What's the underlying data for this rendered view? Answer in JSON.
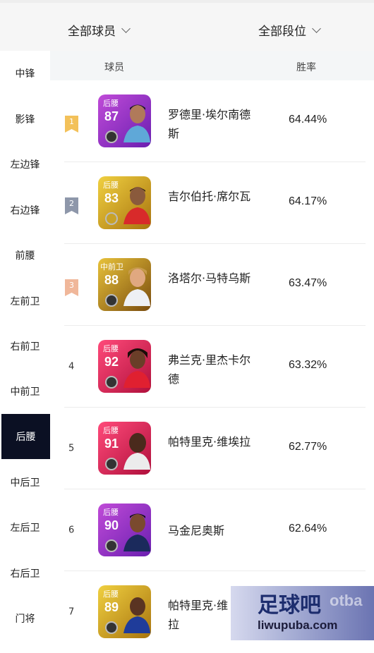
{
  "filters": {
    "players": "全部球员",
    "tiers": "全部段位"
  },
  "sidebar": {
    "items": [
      {
        "label": "中锋",
        "active": false
      },
      {
        "label": "影锋",
        "active": false
      },
      {
        "label": "左边锋",
        "active": false
      },
      {
        "label": "右边锋",
        "active": false
      },
      {
        "label": "前腰",
        "active": false
      },
      {
        "label": "左前卫",
        "active": false
      },
      {
        "label": "右前卫",
        "active": false
      },
      {
        "label": "中前卫",
        "active": false
      },
      {
        "label": "后腰",
        "active": true
      },
      {
        "label": "中后卫",
        "active": false
      },
      {
        "label": "左后卫",
        "active": false
      },
      {
        "label": "右后卫",
        "active": false
      },
      {
        "label": "门将",
        "active": false
      }
    ]
  },
  "table": {
    "headers": {
      "player": "球员",
      "winrate": "胜率"
    },
    "rows": [
      {
        "rank": "1",
        "position": "后腰",
        "rating": "87",
        "name": "罗德里·埃尔南德斯",
        "winrate": "64.44%",
        "card_color": "purple",
        "badge_color": "#f3c15a"
      },
      {
        "rank": "2",
        "position": "后腰",
        "rating": "83",
        "name": "吉尔伯托·席尔瓦",
        "winrate": "64.17%",
        "card_color": "gold",
        "badge_color": "#8e97aa"
      },
      {
        "rank": "3",
        "position": "中前卫",
        "rating": "88",
        "name": "洛塔尔·马特乌斯",
        "winrate": "63.47%",
        "card_color": "gold",
        "badge_color": "#f0b79a"
      },
      {
        "rank": "4",
        "position": "后腰",
        "rating": "92",
        "name": "弗兰克·里杰卡尔德",
        "winrate": "63.32%",
        "card_color": "pink"
      },
      {
        "rank": "5",
        "position": "后腰",
        "rating": "91",
        "name": "帕特里克·维埃拉",
        "winrate": "62.77%",
        "card_color": "pink"
      },
      {
        "rank": "6",
        "position": "后腰",
        "rating": "90",
        "name": "马金尼奥斯",
        "winrate": "62.64%",
        "card_color": "purple"
      },
      {
        "rank": "7",
        "position": "后腰",
        "rating": "89",
        "name": "帕特里克·维",
        "winrate": "",
        "card_color": "gold"
      }
    ]
  },
  "watermark": {
    "title": "足球吧",
    "url": "liwupuba.com",
    "bg_text": "otba"
  },
  "colors": {
    "sidebar_active_bg": "#0b1023",
    "card_purple": "#8a2be2",
    "card_gold": "#c8a02a",
    "card_pink": "#e0245e"
  }
}
